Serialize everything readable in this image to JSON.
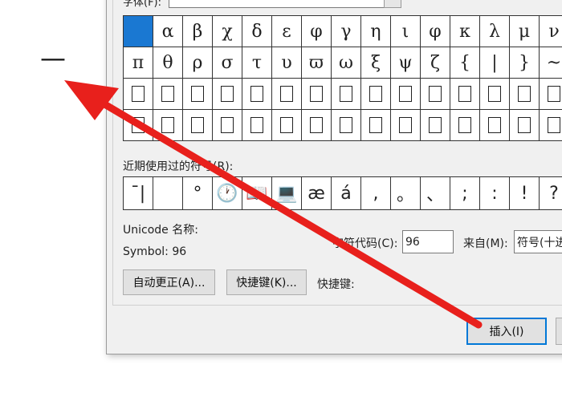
{
  "document": {
    "dash_glyph": "—"
  },
  "dialog": {
    "font_label": "字体(F):",
    "font_value": "",
    "grid_rows": [
      [
        "",
        "α",
        "β",
        "χ",
        "δ",
        "ε",
        "φ",
        "γ",
        "η",
        "ι",
        "φ",
        "κ",
        "λ",
        "μ",
        "ν"
      ],
      [
        "π",
        "θ",
        "ρ",
        "σ",
        "τ",
        "υ",
        "ϖ",
        "ω",
        "ξ",
        "ψ",
        "ζ",
        "{",
        "|",
        "}",
        "~"
      ],
      [
        "□",
        "□",
        "□",
        "□",
        "□",
        "□",
        "□",
        "□",
        "□",
        "□",
        "□",
        "□",
        "□",
        "□",
        "□"
      ],
      [
        "□",
        "□",
        "□",
        "□",
        "□",
        "□",
        "□",
        "□",
        "□",
        "□",
        "□",
        "□",
        "□",
        "□",
        "□"
      ]
    ],
    "recent_label": "近期使用过的符号(R):",
    "recent_symbols": [
      "¯|",
      "",
      "°",
      "🕐",
      "📖",
      "💻",
      "æ",
      "á",
      ",",
      "。",
      "、",
      ";",
      ":",
      "!",
      "?"
    ],
    "unicode_name_label": "Unicode 名称:",
    "symbol_name": "Symbol: 96",
    "char_code_label": "字符代码(C):",
    "char_code_value": "96",
    "from_label": "来自(M):",
    "from_value": "符号(十进",
    "autocorrect_button": "自动更正(A)...",
    "shortcut_button": "快捷键(K)...",
    "shortcut_label": "快捷键:",
    "insert_button": "插入(I)"
  },
  "colors": {
    "arrow": "#e8201c",
    "selected": "#1a78d2",
    "primary_border": "#0078d7"
  }
}
